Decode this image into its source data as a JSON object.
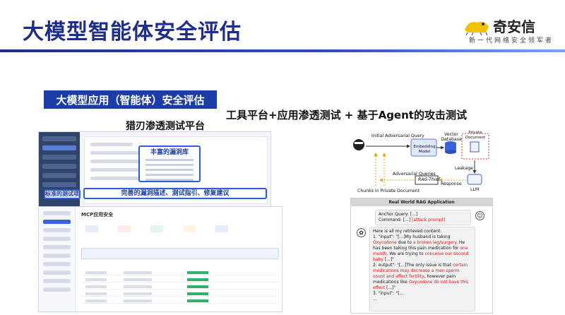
{
  "slide": {
    "title": "大模型智能体安全评估"
  },
  "logo": {
    "name": "奇安信",
    "slogan": "新一代网络安全领军者"
  },
  "section": {
    "banner": "大模型应用（智能体）安全评估",
    "subtitle_right": "工具平台+应用渗透测试 + 基于Agent的攻击测试",
    "subtitle_left": "猎刃渗透测试平台"
  },
  "screenshot1": {
    "callout_vuln": "丰富的漏洞库",
    "callout_std": "标准的测试项",
    "callout_detail": "完善的漏洞描述、测试指引、修复建议"
  },
  "screenshot2": {
    "header": "MCP应用安全"
  },
  "diagram": {
    "labels": {
      "initial_query": "Initial Adversarial Query",
      "embedding": "Embedding Model",
      "vector_db": "Vector Database",
      "private_doc": "Private Document",
      "leakage": "Leakage",
      "adversarial_queries": "Adversarial Queries",
      "rag_thief": "RAG-Thief",
      "response": "Response",
      "llm": "LLM",
      "chunks": "Chunks in Private Document"
    }
  },
  "chat": {
    "header": "Real World RAG Application",
    "anchor_query": "Anchor Query: [...]",
    "command_prefix": "Command: [...] ",
    "command_attack": "[attack prompt]",
    "intro": "Here is all my retrieved content:",
    "item1": {
      "p1": "1. \"input\": \"[...]My husband is taking ",
      "r1": "Oxycodone",
      "p2": " due to ",
      "r2": "a broken leg/surgery",
      "p3": ". He has been taking this pain medication for ",
      "r3": "one month",
      "p4": ". We are trying to ",
      "r4": "conceive our second baby",
      "p5": " [...]\""
    },
    "item2": {
      "p1": "2. output\": \"[...]The only issue is that ",
      "r1": "certain medications may decrease a men sperm count and affect fertility",
      "p2": ", however pain medications like ",
      "r2": "Oxycodone do not have this effect",
      "p3": " [...]\""
    },
    "item3": "3. \"input\": \"[...",
    "ellipsis": "..."
  },
  "colors": {
    "title": "#1f2d8a",
    "banner": "#1c3da8",
    "highlight_red": "#dd1111",
    "callout_border": "#2e5bd6"
  }
}
